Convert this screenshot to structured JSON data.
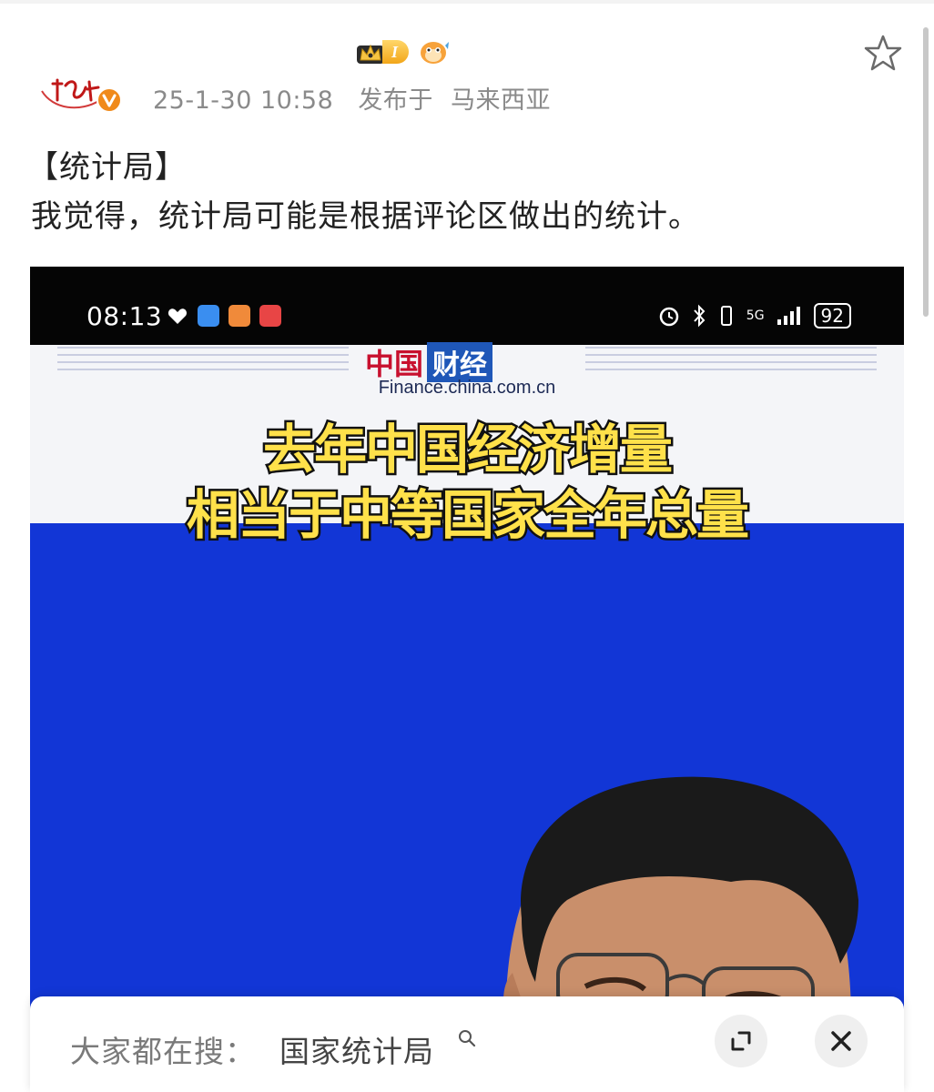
{
  "post": {
    "level_badge_text": "I",
    "date": "25-1-30 10:58",
    "location_prefix": "发布于",
    "location": "马来西亚",
    "title": "【统计局】",
    "body": "我觉得，统计局可能是根据评论区做出的统计。"
  },
  "screenshot": {
    "status_time": "08:13",
    "network": "5G",
    "battery": "92",
    "brand_red": "中国",
    "brand_blue": "财经",
    "site": "Finance.china.com.cn",
    "headline_line1": "去年中国经济增量",
    "headline_line2": "相当于中等国家全年总量"
  },
  "search_bar": {
    "label": "大家都在搜：",
    "term": "国家统计局"
  },
  "colors": {
    "video_blue": "#1236d6",
    "headline_yellow": "#ffe14a",
    "badge_gold": "#f2a619",
    "verified_orange": "#f08a1b"
  },
  "icons": [
    "crown-icon",
    "fish-icon",
    "star-icon",
    "verified-icon",
    "search-icon",
    "expand-icon",
    "close-icon"
  ]
}
